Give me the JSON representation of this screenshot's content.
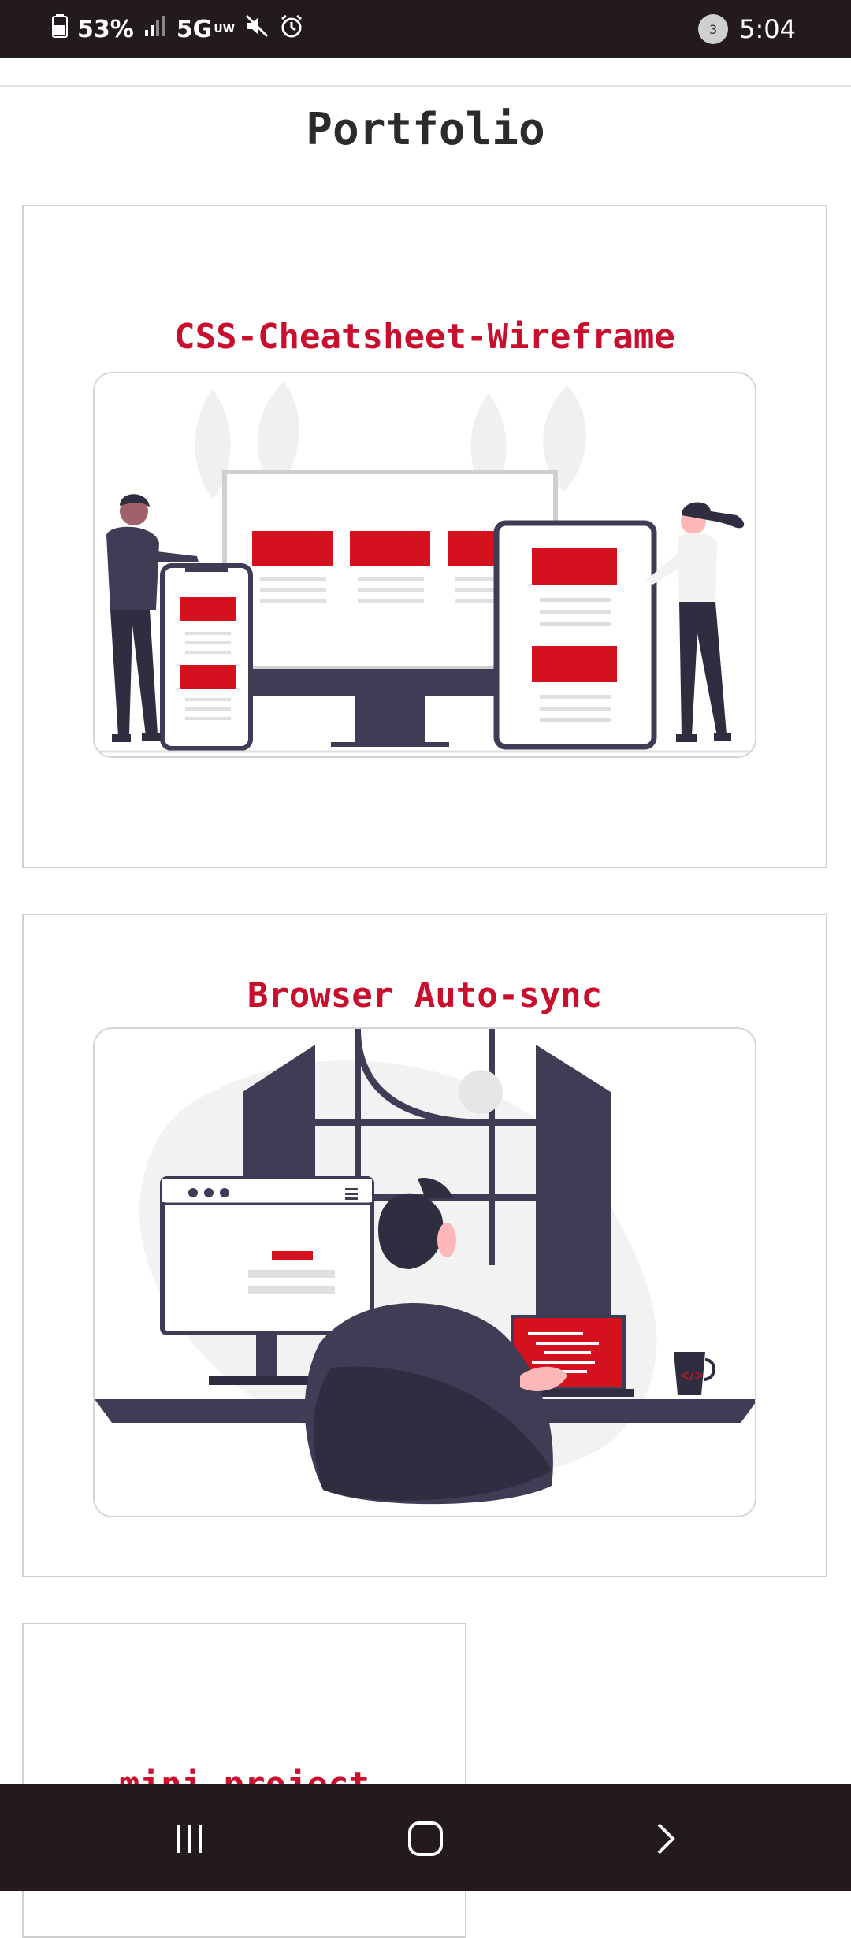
{
  "status_bar": {
    "battery": "53%",
    "network": "5G",
    "network_sub": "UW",
    "notification_count": "3",
    "time": "5:04"
  },
  "page": {
    "title": "Portfolio"
  },
  "projects": [
    {
      "title": "CSS-Cheatsheet-Wireframe"
    },
    {
      "title": "Browser Auto-sync"
    },
    {
      "title": "mini-project"
    }
  ],
  "colors": {
    "accent": "#c8102e",
    "illustration_red": "#d6111f",
    "dark_figure": "#3f3d56",
    "status_bar_bg": "#231b1b"
  },
  "icons": {
    "battery": "battery-icon",
    "signal": "signal-icon",
    "mute": "mute-icon",
    "alarm": "alarm-icon",
    "recents": "recents-icon",
    "home": "home-icon",
    "back": "back-icon"
  }
}
